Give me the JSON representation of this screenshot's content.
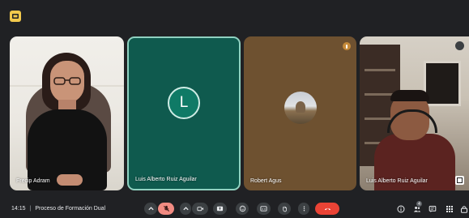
{
  "tiles": [
    {
      "name": "Frecip Adram",
      "kind": "video"
    },
    {
      "name": "Luis Alberto Ruiz Aguilar",
      "kind": "avatar",
      "initial": "L",
      "color": "#0f7a66"
    },
    {
      "name": "Robert Agus",
      "kind": "avatar-photo"
    },
    {
      "name": "Luis Alberto Ruiz Aguilar",
      "kind": "video"
    }
  ],
  "meeting": {
    "time": "14:15",
    "separator": "|",
    "title": "Proceso de Formación Dual"
  },
  "controls": [
    "chevron-up-icon",
    "mic-off-icon",
    "chevron-up-icon",
    "camera-icon",
    "present-icon",
    "emoji-icon",
    "captions-icon",
    "raise-hand-icon",
    "more-icon",
    "end-call-icon"
  ],
  "participant_count": "4",
  "colors": {
    "background": "#202124",
    "accent": "#0f7a66",
    "end_call": "#ea4335",
    "mic_off": "#f28b82"
  }
}
